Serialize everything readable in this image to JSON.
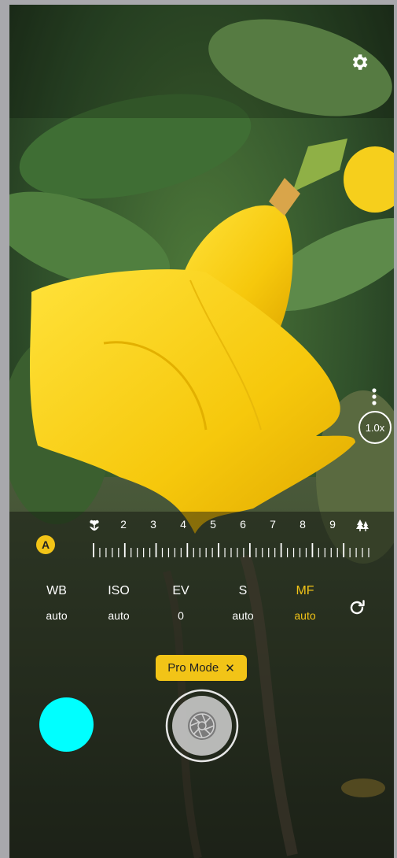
{
  "colors": {
    "accent": "#f2c417",
    "gallery_thumb": "#00ffff"
  },
  "top": {
    "settings_icon": "gear-icon"
  },
  "side": {
    "more_icon": "vertical-dots-icon",
    "zoom_label": "1.0x"
  },
  "focus": {
    "auto_label": "A",
    "near_icon": "flower-macro-icon",
    "far_icon": "tree-landscape-icon",
    "scale_numbers": [
      "2",
      "3",
      "4",
      "5",
      "6",
      "7",
      "8",
      "9"
    ]
  },
  "params": [
    {
      "name": "WB",
      "value": "auto",
      "active": false
    },
    {
      "name": "ISO",
      "value": "auto",
      "active": false
    },
    {
      "name": "EV",
      "value": "0",
      "active": false
    },
    {
      "name": "S",
      "value": "auto",
      "active": false
    },
    {
      "name": "MF",
      "value": "auto",
      "active": true
    }
  ],
  "reset_icon": "reset-icon",
  "mode": {
    "label": "Pro Mode",
    "close": "✕"
  },
  "shutter_icon": "aperture-icon",
  "gallery_icon": "gallery-thumbnail"
}
